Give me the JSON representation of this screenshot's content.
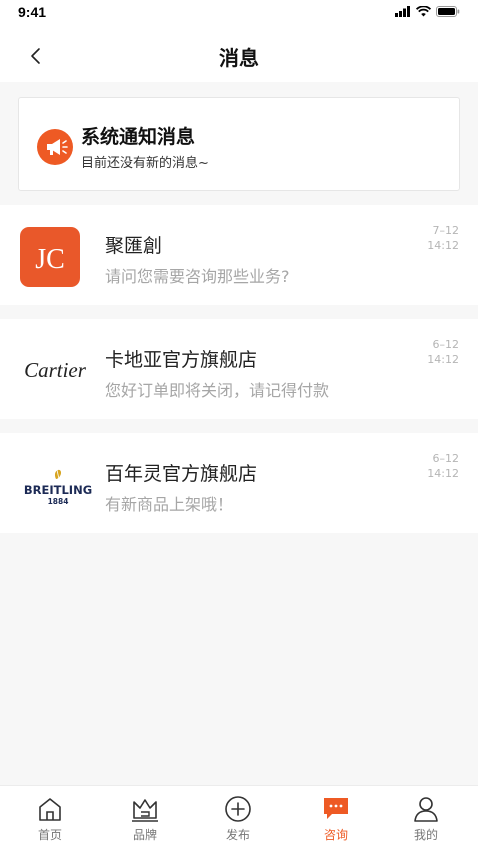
{
  "status_bar": {
    "time": "9:41"
  },
  "header": {
    "title": "消息"
  },
  "system_notice": {
    "title": "系统通知消息",
    "subtitle": "目前还没有新的消息~"
  },
  "messages": [
    {
      "name": "聚匯創",
      "preview": "请问您需要咨询那些业务?",
      "date": "7–12",
      "time": "14:12",
      "logo_text": "JC"
    },
    {
      "name": "卡地亚官方旗舰店",
      "preview": "您好订单即将关闭，请记得付款",
      "date": "6–12",
      "time": "14:12",
      "logo_text": "Cartier"
    },
    {
      "name": "百年灵官方旗舰店",
      "preview": "有新商品上架哦！",
      "date": "6–12",
      "time": "14:12",
      "logo_text": "BREITLING",
      "logo_year": "1884"
    }
  ],
  "tabs": [
    {
      "label": "首页",
      "icon": "home-icon",
      "active": false
    },
    {
      "label": "品牌",
      "icon": "crown-icon",
      "active": false
    },
    {
      "label": "发布",
      "icon": "plus-circle-icon",
      "active": false
    },
    {
      "label": "咨询",
      "icon": "chat-icon",
      "active": true
    },
    {
      "label": "我的",
      "icon": "user-icon",
      "active": false
    }
  ],
  "colors": {
    "accent": "#ee5a24",
    "muted_text": "#a6a6a6",
    "background": "#f7f7f7"
  }
}
